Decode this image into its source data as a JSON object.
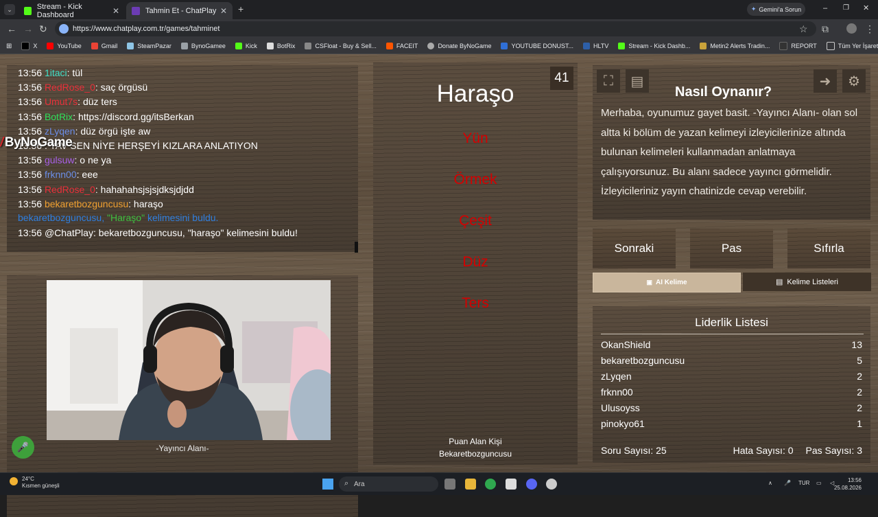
{
  "browser": {
    "tabs": [
      {
        "title": "Stream - Kick Dashboard",
        "active": false,
        "icon_color": "#53fc18"
      },
      {
        "title": "Tahmin Et - ChatPlay",
        "active": true,
        "icon_color": "#6c3cb4"
      }
    ],
    "gemini_label": "Gemini'a Sorun",
    "url": "https://www.chatplay.com.tr/games/tahminet",
    "bookmarks": [
      "X",
      "YouTube",
      "Gmail",
      "SteamPazar",
      "BynoGamee",
      "Kick",
      "BotRix",
      "CSFloat - Buy & Sell...",
      "FACEIT",
      "Donate ByNoGame",
      "YOUTUBE DONUST...",
      "HLTV",
      "Stream - Kick Dashb...",
      "Metin2 Alerts Tradin...",
      "REPORT"
    ],
    "all_bookmarks": "Tüm Yer İşaretleri"
  },
  "chat": {
    "messages": [
      {
        "time": "13:56",
        "user": "1itaci",
        "color": "#3fe0c8",
        "text": ": tül"
      },
      {
        "time": "13:56",
        "user": "RedRose_0",
        "color": "#e8303a",
        "text": ": saç örgüsü"
      },
      {
        "time": "13:56",
        "user": "Umut7s",
        "color": "#e8303a",
        "text": ": düz ters"
      },
      {
        "time": "13:56",
        "user": "BotRix",
        "color": "#2ee05a",
        "text": ": https://discord.gg/itsBerkan"
      },
      {
        "time": "13:56",
        "user": "zLyqen",
        "color": "#6b8ee8",
        "text": ": düz örgü işte aw"
      },
      {
        "time": "13:56",
        "user": "",
        "color": "#e8303a",
        "text": ": YAV SEN NİYE HERŞEYİ KIZLARA ANLATIYON"
      },
      {
        "time": "13:56",
        "user": "gulsuw",
        "color": "#a860e8",
        "text": ": o ne ya"
      },
      {
        "time": "13:56",
        "user": "frknn00",
        "color": "#6b8ee8",
        "text": ": eee"
      },
      {
        "time": "13:56",
        "user": "RedRose_0",
        "color": "#e8303a",
        "text": ": hahahahsjsjsjdksjdjdd"
      },
      {
        "time": "13:56",
        "user": "bekaretbozguncusu",
        "color": "#f0a030",
        "text": ": haraşo"
      }
    ],
    "found_notice": {
      "user": "bekaretbozguncusu",
      "word": "\"Haraşo\"",
      "rest": " kelimesini buldu."
    },
    "bot_line": {
      "time": "13:56",
      "text": "@ChatPlay: bekaretbozguncusu, \"haraşo\" kelimesini buldu!"
    },
    "overlay_logo": "ByNoGame"
  },
  "camera": {
    "caption": "-Yayıncı Alanı-"
  },
  "game": {
    "timer": "41",
    "word": "Haraşo",
    "forbidden": [
      "Yün",
      "Örmek",
      "Çeşit",
      "Düz",
      "Ters"
    ],
    "scorer_label": "Puan Alan Kişi",
    "scorer_name": "Bekaretbozguncusu"
  },
  "howto": {
    "title": "Nasıl Oynanır?",
    "text": "Merhaba, oyunumuz gayet basit. -Yayıncı Alanı- olan sol altta ki bölüm de yazan kelimeyi izleyicilerinize altında bulunan kelimeleri kullanmadan anlatmaya çalışıyorsunuz. Bu alanı sadece yayıncı görmelidir. İzleyicileriniz yayın chatinizde cevap verebilir."
  },
  "controls": {
    "next": "Sonraki",
    "pass": "Pas",
    "reset": "Sıfırla",
    "ai_word": "AI Kelime",
    "word_lists": "Kelime Listeleri"
  },
  "leaderboard": {
    "title": "Liderlik Listesi",
    "rows": [
      {
        "name": "OkanShield",
        "score": "13"
      },
      {
        "name": "bekaretbozguncusu",
        "score": "5"
      },
      {
        "name": "zLyqen",
        "score": "2"
      },
      {
        "name": "frknn00",
        "score": "2"
      },
      {
        "name": "Ulusoyss",
        "score": "2"
      },
      {
        "name": "pinokyo61",
        "score": "1"
      }
    ],
    "question_count": "Soru Sayısı: 25",
    "error_count": "Hata Sayısı: 0",
    "pass_count": "Pas Sayısı: 3"
  },
  "taskbar": {
    "temperature": "24°C",
    "weather": "Kısmen güneşli",
    "search_placeholder": "Ara",
    "lang": "TUR",
    "time": "13:56",
    "date": "25.08.2026"
  }
}
